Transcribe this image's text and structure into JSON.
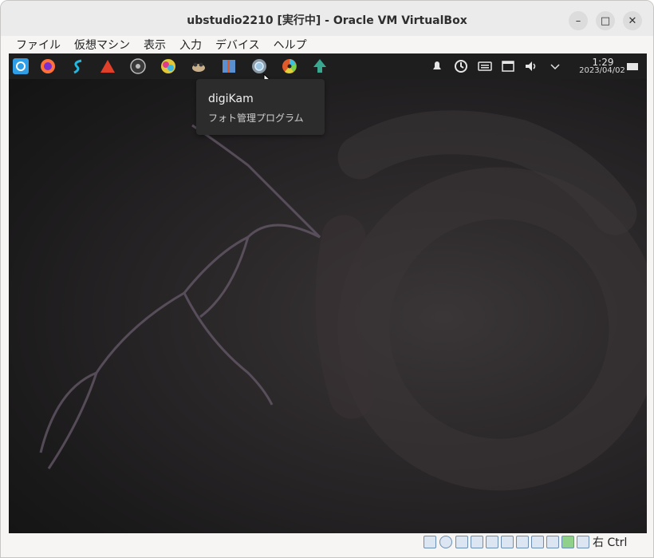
{
  "window": {
    "title": "ubstudio2210 [実行中] - Oracle VM VirtualBox",
    "minimize_label": "–",
    "maximize_label": "□",
    "close_label": "✕"
  },
  "menubar": {
    "items": [
      "ファイル",
      "仮想マシン",
      "表示",
      "入力",
      "デバイス",
      "ヘルプ"
    ]
  },
  "panel": {
    "apps": [
      {
        "name": "ubuntu-studio-menu-icon",
        "color": "#2e9fe6"
      },
      {
        "name": "firefox-icon",
        "color": "#ff7139"
      },
      {
        "name": "synfig-icon",
        "color": "#22b8e0"
      },
      {
        "name": "ardour-icon",
        "color": "#e0402a"
      },
      {
        "name": "obs-icon",
        "color": "#bdbdbd"
      },
      {
        "name": "krita-icon",
        "color": "#e0c83a"
      },
      {
        "name": "gimp-icon",
        "color": "#c9b08a"
      },
      {
        "name": "kdenlive-icon",
        "color": "#5a8fd0"
      },
      {
        "name": "digikam-icon",
        "color": "#9ec6e0"
      },
      {
        "name": "darktable-icon",
        "color": "#e05a2a"
      },
      {
        "name": "inkscape-icon",
        "color": "#3aa890"
      }
    ],
    "clock": {
      "time": "1:29",
      "date": "2023/04/02"
    }
  },
  "tooltip": {
    "title": "digiKam",
    "subtitle": "フォト管理プログラム"
  },
  "statusbar": {
    "host_key": "右 Ctrl"
  }
}
